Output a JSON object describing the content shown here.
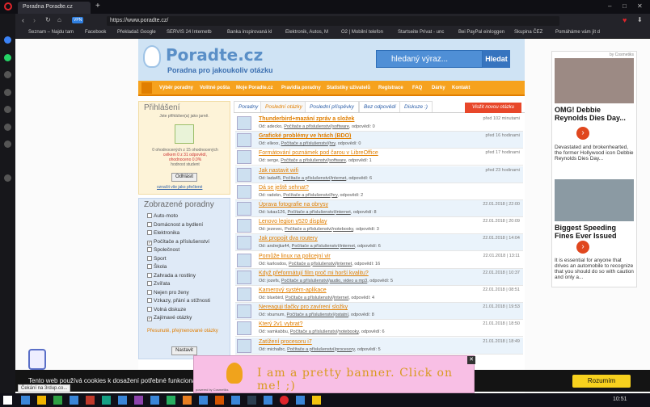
{
  "browser": {
    "tab_title": "Poradna Poradte.cz",
    "url": "https://www.poradte.cz/",
    "vpn_label": "VPN",
    "bookmarks": [
      "Seznam – Najdu tam",
      "Facebook",
      "Překladač Google",
      "SERVIS 24 Internetb",
      "Banka inspirovaná kl",
      "Elektronik, Autos, M",
      "O2 | Mobilní telefon",
      "Startseite Privat - unc",
      "Bei PayPal einloggen",
      "Skupina ČEZ",
      "Pomáháme vám jít d"
    ],
    "status_text": "Čekání na 3rdup.co...",
    "clock": "10:51",
    "window_controls": [
      "–",
      "□",
      "✕"
    ]
  },
  "header": {
    "logo_title": "Poradte.cz",
    "logo_subtitle": "Poradna pro jakoukoliv otázku",
    "search_placeholder": "hledaný výraz...",
    "search_button": "Hledat"
  },
  "nav": [
    "Výběr poradny",
    "Volitné pošta",
    "Moje Poradte.cz",
    "Pravidla poradny",
    "Statistiky uživatelů",
    "Registrace",
    "FAQ",
    "Dárky",
    "Kontakt"
  ],
  "login": {
    "title": "Přihlášení",
    "hint": "Jste přihlášen(a) jako jarně.",
    "stats_line1": "0 ohodnocených z 15 ohodnocených",
    "stats_line2": "celkem 0 z 31 odpovědí,",
    "stats_line3": "ohodnoceno 0.0%",
    "stats_line4": "hodnost student",
    "logout_button": "Odhlásit",
    "link": "označit vše jako přečtené"
  },
  "categories_box": {
    "title": "Zobrazené poradny",
    "items": [
      {
        "label": "Auto-moto",
        "checked": false
      },
      {
        "label": "Domácnost a bydlení",
        "checked": false
      },
      {
        "label": "Elektronika",
        "checked": false
      },
      {
        "label": "Počítače a příslušenství",
        "checked": true
      },
      {
        "label": "Společnost",
        "checked": false
      },
      {
        "label": "Sport",
        "checked": false
      },
      {
        "label": "Škola",
        "checked": false
      },
      {
        "label": "Zahrada a rostliny",
        "checked": false
      },
      {
        "label": "Zvířata",
        "checked": false
      },
      {
        "label": "Nejen pro ženy",
        "checked": false
      },
      {
        "label": "Vzkazy, přání a stížnosti",
        "checked": false
      },
      {
        "label": "Volná diskuze",
        "checked": false
      },
      {
        "label": "Zajímavé otázky",
        "checked": true
      }
    ],
    "extra": "Přesunuté, přejmenované otázky",
    "set_button": "Nastavit"
  },
  "tabs": [
    "Poradny",
    "Poslední otázky",
    "Poslední příspěvky",
    "Bez odpovědí",
    "Diskuze :)"
  ],
  "ask_button": "Vložit novou otázku",
  "questions": [
    {
      "title": "Thunderbird+mazání zpráv a složek",
      "author": "Od: adecko",
      "category": "Počítače a příslušenství",
      "sub": "software",
      "answers": "odpovědí: 0",
      "date": "před 102 minutami",
      "bold": true
    },
    {
      "title": "Grafické problémy ve hrách (BDO)",
      "author": "Od: ellexx",
      "category": "Počítače a příslušenství",
      "sub": "hry",
      "answers": "odpovědí: 0",
      "date": "před 16 hodinami",
      "bold": true
    },
    {
      "title": "Formátování poznámek pod čarou v LibreOffice",
      "author": "Od: serge",
      "category": "Počítače a příslušenství",
      "sub": "software",
      "answers": "odpovědí: 1",
      "date": "před 17 hodinami",
      "bold": false
    },
    {
      "title": "Jak nastavit wifi",
      "author": "Od: lada45",
      "category": "Počítače a příslušenství",
      "sub": "internet",
      "answers": "odpovědí: 6",
      "date": "před 23 hodinami",
      "bold": false
    },
    {
      "title": "Dá se ještě sehnat?",
      "author": "Od: radekn",
      "category": "Počítače a příslušenství",
      "sub": "hry",
      "answers": "odpovědí: 2",
      "date": "",
      "bold": false
    },
    {
      "title": "Úprava fotografie na obrysy",
      "author": "Od: lukas126",
      "category": "Počítače a příslušenství",
      "sub": "internet",
      "answers": "odpovědí: 8",
      "date": "22.01.2018 | 22:00",
      "bold": false
    },
    {
      "title": "Lenovo legion y520 display",
      "author": "Od: jezevec",
      "category": "Počítače a příslušenství",
      "sub": "notebooky",
      "answers": "odpovědí: 3",
      "date": "22.01.2018 | 20:09",
      "bold": false
    },
    {
      "title": "Jak propojit dva routery",
      "author": "Od: andrejka44",
      "category": "Počítače a příslušenství",
      "sub": "internet",
      "answers": "odpovědí: 6",
      "date": "22.01.2018 | 14:04",
      "bold": false
    },
    {
      "title": "Pomůže linux na policejní vir",
      "author": "Od: karlosdos",
      "category": "Počítače a příslušenství",
      "sub": "internet",
      "answers": "odpovědí: 16",
      "date": "22.01.2018 | 13:11",
      "bold": false
    },
    {
      "title": "Když přeformátují film proč mi horší kvalitu?",
      "author": "Od: jozefs",
      "category": "Počítače a příslušenství",
      "sub": "audio, video a mp3",
      "answers": "odpovědí: 5",
      "date": "22.01.2018 | 10:37",
      "bold": false
    },
    {
      "title": "Kamerový systém-aplikace",
      "author": "Od: bluebird",
      "category": "Počítače a příslušenství",
      "sub": "internet",
      "answers": "odpovědí: 4",
      "date": "22.01.2018 | 08:51",
      "bold": false
    },
    {
      "title": "Nereaguji tlačky pro zavírení složky",
      "author": "Od: vbumum",
      "category": "Počítače a příslušenství",
      "sub": "ostatní",
      "answers": "odpovědí: 8",
      "date": "21.01.2018 | 19:53",
      "bold": false
    },
    {
      "title": "Který 2v1 vybrat?",
      "author": "Od: vamkabbu",
      "category": "Počítače a příslušenství",
      "sub": "notebooky",
      "answers": "odpovědí: 6",
      "date": "21.01.2018 | 18:50",
      "bold": false
    },
    {
      "title": "Zatížení procesoru i7",
      "author": "Od: michalbc",
      "category": "Počítače a příslušenství",
      "sub": "procesory",
      "answers": "odpovědí: 5",
      "date": "21.01.2018 | 18:49",
      "bold": false
    }
  ],
  "ad": {
    "by": "by Cosmetiks",
    "h1": "OMG! Debbie Reynolds Dies Day...",
    "t1": "Devastated and brokenhearted, the former Hollywood icon Debbie Reynolds Dies Day...",
    "h2": "Biggest Speeding Fines Ever Issued",
    "t2": "It is essential for anyone that drives an automobile to recognize that you should do so with caution and only a..."
  },
  "cookie": {
    "text": "Tento web používá cookies k dosažení potřebné funkcionality.",
    "button": "Rozumím"
  },
  "banner": {
    "text": "I am a pretty banner. Click on me! ;)",
    "close": "✕",
    "powered": "powered by Cosmetiks"
  }
}
